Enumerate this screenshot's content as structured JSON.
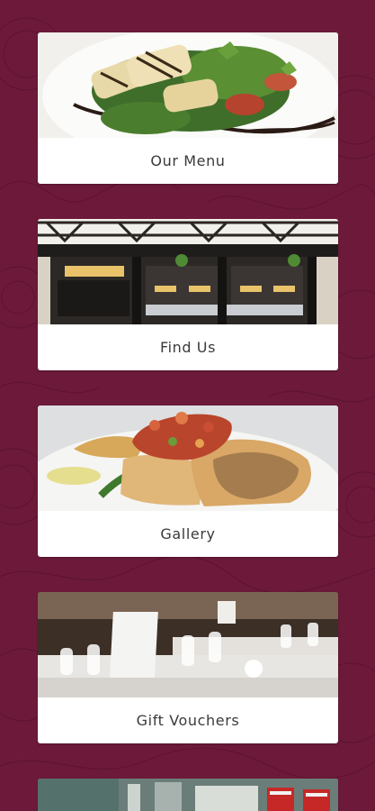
{
  "colors": {
    "background": "#6d1a3a",
    "card": "#ffffff",
    "label_text": "#3a3a3a"
  },
  "menu": {
    "items": [
      {
        "label": "Our Menu",
        "image": "grilled-halloumi-salad-photo"
      },
      {
        "label": "Find Us",
        "image": "restaurant-storefront-photo"
      },
      {
        "label": "Gallery",
        "image": "fish-dish-photo"
      },
      {
        "label": "Gift Vouchers",
        "image": "dining-room-photo"
      },
      {
        "label": "",
        "image": "bar-interior-photo"
      }
    ]
  }
}
